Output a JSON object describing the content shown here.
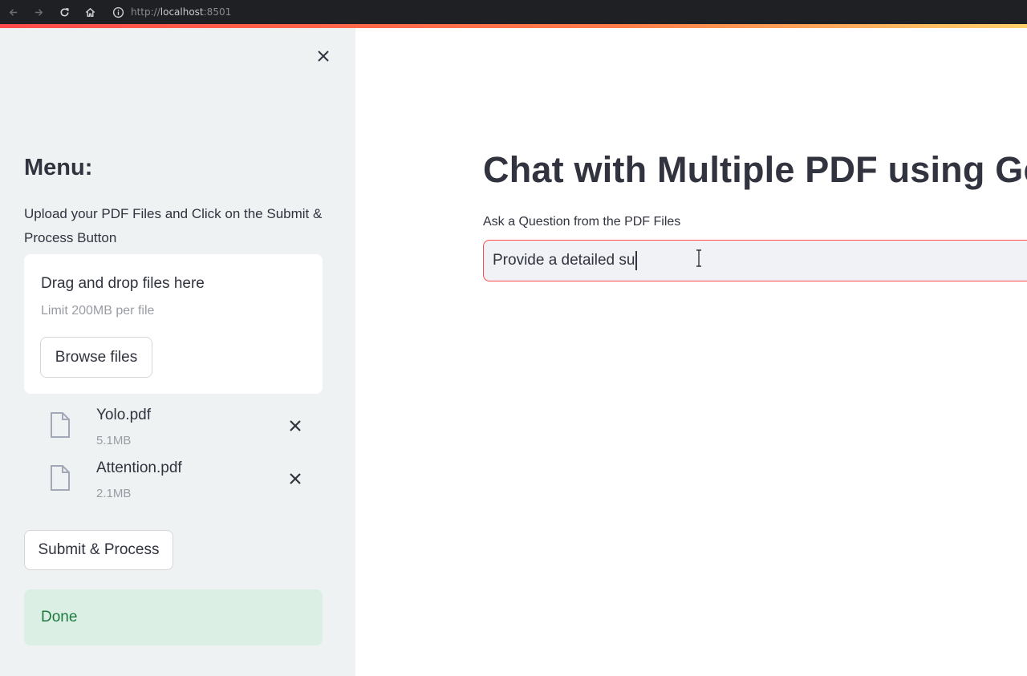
{
  "browser": {
    "url_scheme": "http://",
    "url_host": "localhost",
    "url_port": ":8501",
    "icons": [
      "back-arrow-icon",
      "forward-arrow-icon",
      "reload-icon",
      "home-icon",
      "site-info-icon"
    ]
  },
  "sidebar": {
    "menu_title": "Menu:",
    "description": "Upload your PDF Files and Click on the Submit & Process Button",
    "uploader": {
      "drop_label": "Drag and drop files here",
      "limit_label": "Limit 200MB per file",
      "browse_label": "Browse files"
    },
    "files": [
      {
        "name": "Yolo.pdf",
        "size": "5.1MB"
      },
      {
        "name": "Attention.pdf",
        "size": "2.1MB"
      }
    ],
    "submit_label": "Submit & Process",
    "status_message": "Done"
  },
  "main": {
    "title": "Chat with Multiple PDF using Gem",
    "question_label": "Ask a Question from the PDF Files",
    "question_value": "Provide a detailed su"
  },
  "colors": {
    "accent": "#ff4b4b",
    "sidebar_bg": "#eef2f3",
    "success_bg": "#dcefe4",
    "success_text": "#1c7a3f"
  }
}
